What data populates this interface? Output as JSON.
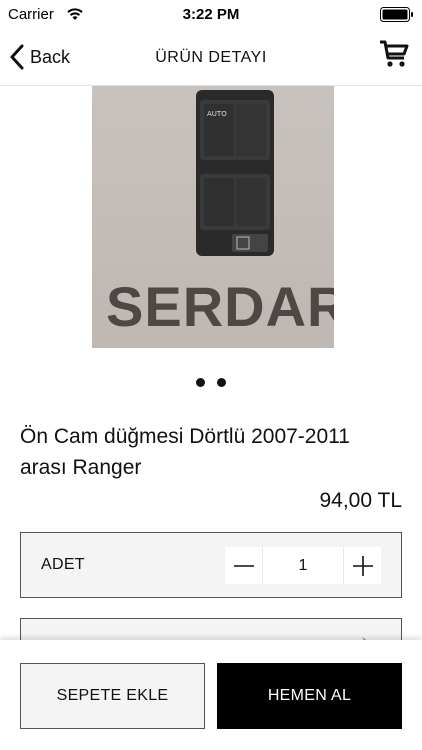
{
  "status_bar": {
    "carrier": "Carrier",
    "time": "3:22 PM"
  },
  "nav": {
    "back_label": "Back",
    "title": "ÜRÜN DETAYI",
    "cart_icon": "cart-icon"
  },
  "product": {
    "image_watermark": "SERDAR",
    "image_button_label": "AUTO",
    "page_dots": 2,
    "title": "Ön Cam düğmesi Dörtlü 2007-2011 arası Ranger",
    "price": "94,00 TL"
  },
  "quantity": {
    "label": "ADET",
    "value": "1",
    "minus_icon": "minus-icon",
    "plus_icon": "plus-icon"
  },
  "actions": {
    "add_to_cart": "SEPETE EKLE",
    "buy_now": "HEMEN AL"
  },
  "colors": {
    "primary_button_bg": "#000000",
    "secondary_button_bg": "#f4f4f4",
    "border": "#555555"
  }
}
